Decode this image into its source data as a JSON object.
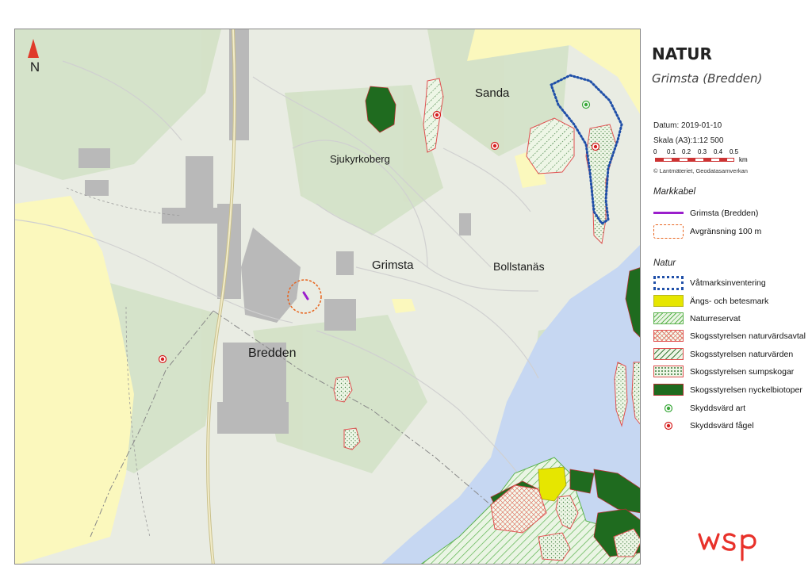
{
  "north_label": "N",
  "places": {
    "sanda": "Sanda",
    "sjukyrkoberg": "Sjukyrkoberg",
    "grimsta": "Grimsta",
    "bollstanas": "Bollstanäs",
    "bredden": "Bredden"
  },
  "legend": {
    "title": "NATUR",
    "subtitle": "Grimsta (Bredden)",
    "datum": "Datum: 2019-01-10",
    "skala": "Skala (A3):1:12 500",
    "scale_ticks": [
      "0",
      "0.1",
      "0.2",
      "0.3",
      "0.4",
      "0.5"
    ],
    "scale_unit": "km",
    "credit": "© Lantmäteriet, Geodatasamverkan",
    "markkabel_heading": "Markkabel",
    "markkabel_items": [
      {
        "label": "Grimsta (Bredden)",
        "color": "#9b1fcc"
      },
      {
        "label": "Avgränsning 100 m",
        "color": "#e8641e"
      }
    ],
    "natur_heading": "Natur",
    "natur_items": [
      {
        "label": "Våtmarksinventering",
        "color": "#1f4fa8"
      },
      {
        "label": "Ängs- och betesmark",
        "color": "#e6e600"
      },
      {
        "label": "Naturreservat",
        "color": "#6bbf59"
      },
      {
        "label": "Skogsstyrelsen naturvärdsavtal",
        "color": "#e05050"
      },
      {
        "label": "Skogsstyrelsen naturvärden",
        "color": "#e05050"
      },
      {
        "label": "Skogsstyrelsen sumpskogar",
        "color": "#e05050"
      },
      {
        "label": "Skogsstyrelsen nyckelbiotoper",
        "color": "#1f6b1f"
      },
      {
        "label": "Skyddsvärd art",
        "color": "#3aa83a"
      },
      {
        "label": "Skyddsvärd fågel",
        "color": "#d62020"
      }
    ]
  },
  "logo_text": "wsp",
  "colors": {
    "land": "#e9ece3",
    "forest": "#d3e2c6",
    "buildings": "#b9b9b9",
    "water": "#c6d7f2",
    "yellow_area": "#fbf8bd",
    "logo": "#e8312a"
  }
}
